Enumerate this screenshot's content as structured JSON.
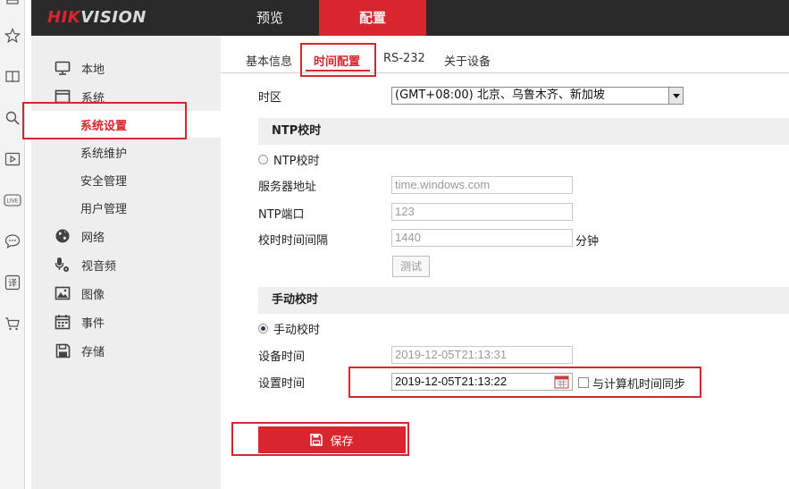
{
  "brand": {
    "logo_primary": "HIK",
    "logo_secondary": "VISION"
  },
  "topnav": {
    "preview": "预览",
    "config": "配置"
  },
  "sidebar": {
    "items": [
      {
        "label": "本地",
        "icon": "monitor-icon"
      },
      {
        "label": "系统",
        "icon": "window-icon"
      },
      {
        "label": "系统设置",
        "selected": true
      },
      {
        "label": "系统维护"
      },
      {
        "label": "安全管理"
      },
      {
        "label": "用户管理"
      },
      {
        "label": "网络",
        "icon": "globe-icon"
      },
      {
        "label": "视音频",
        "icon": "microphone-icon"
      },
      {
        "label": "图像",
        "icon": "image-icon"
      },
      {
        "label": "事件",
        "icon": "calendar-icon"
      },
      {
        "label": "存储",
        "icon": "floppy-disk-icon"
      }
    ]
  },
  "tabs": [
    {
      "label": "基本信息"
    },
    {
      "label": "时间配置",
      "active": true
    },
    {
      "label": "RS-232"
    },
    {
      "label": "关于设备"
    }
  ],
  "form": {
    "timezone_label": "时区",
    "timezone_value": "(GMT+08:00) 北京、乌鲁木齐、新加坡",
    "ntp_section": "NTP校时",
    "ntp_radio_label": "NTP校时",
    "ntp_selected": false,
    "server_label": "服务器地址",
    "server_value": "time.windows.com",
    "port_label": "NTP端口",
    "port_value": "123",
    "interval_label": "校时时间间隔",
    "interval_value": "1440",
    "interval_unit": "分钟",
    "test_button": "测试",
    "manual_section": "手动校时",
    "manual_radio_label": "手动校时",
    "manual_selected": true,
    "device_time_label": "设备时间",
    "device_time_value": "2019-12-05T21:13:31",
    "set_time_label": "设置时间",
    "set_time_value": "2019-12-05T21:13:22",
    "sync_label": "与计算机时间同步",
    "sync_checked": false,
    "save_button": "保存"
  },
  "colors": {
    "accent": "#d8262e",
    "header_bg": "#2a2a2a",
    "sidebar_bg": "#eeeeee"
  }
}
